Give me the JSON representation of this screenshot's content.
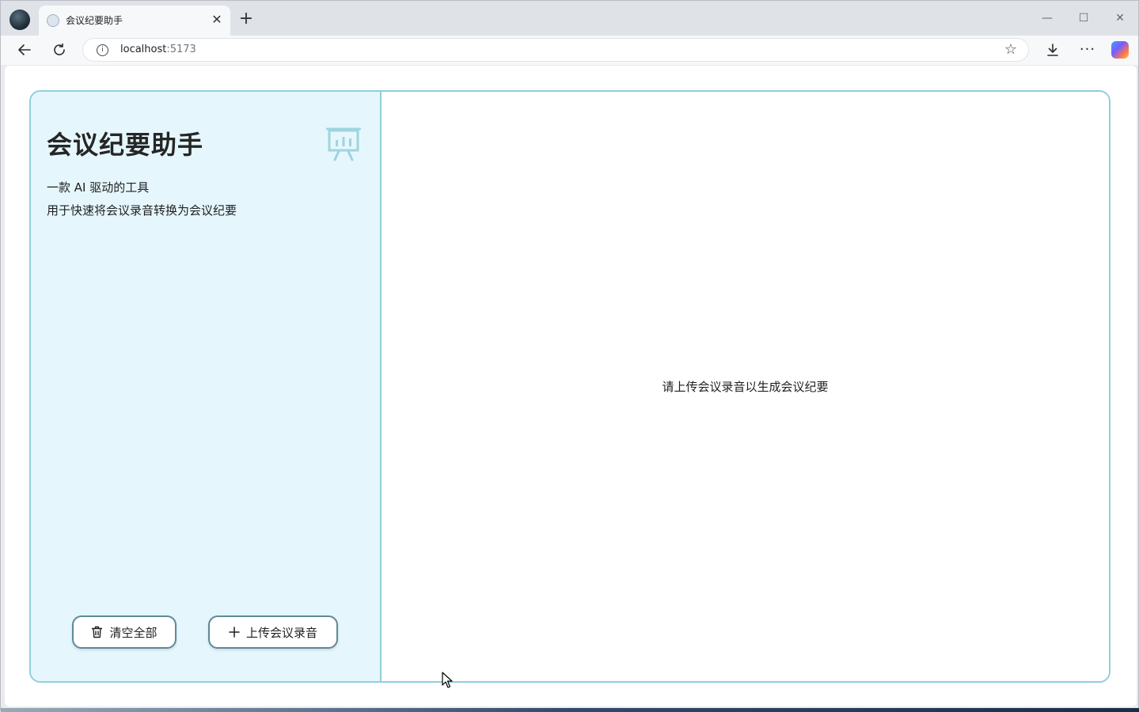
{
  "browser": {
    "tab_title": "会议纪要助手",
    "tab_close": "✕",
    "new_tab": "+",
    "window_controls": {
      "minimize": "—",
      "maximize": "☐",
      "close": "✕"
    },
    "url_host": "localhost",
    "url_port": ":5173",
    "icons": {
      "back": "arrow-left-icon",
      "reload": "reload-icon",
      "info": "info-icon",
      "favorite": "star-icon",
      "downloads": "download-icon",
      "menu": "more-icon",
      "copilot": "copilot-icon"
    }
  },
  "sidebar": {
    "title": "会议纪要助手",
    "description_line1": "一款 AI 驱动的工具",
    "description_line2": "用于快速将会议录音转换为会议纪要",
    "clear_button_label": "清空全部",
    "upload_button_label": "上传会议录音"
  },
  "main": {
    "placeholder_text": "请上传会议录音以生成会议纪要"
  },
  "colors": {
    "accent_border": "#8fcfd9",
    "sidebar_bg": "#e5f7fd",
    "button_border": "#5e8a97"
  }
}
